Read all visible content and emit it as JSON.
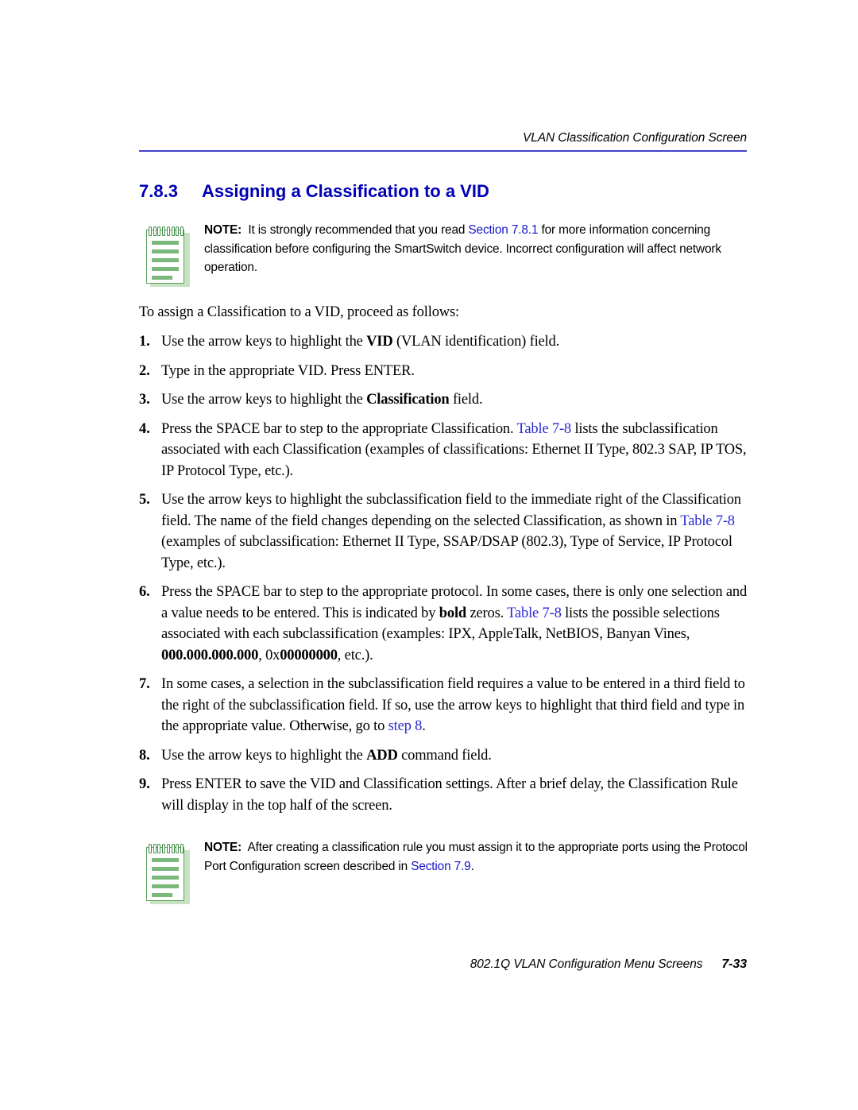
{
  "page": {
    "running_header": "VLAN Classification Configuration Screen",
    "heading_number": "7.8.3",
    "heading_title": "Assigning a Classification to a VID",
    "intro": "To assign a Classification to a VID, proceed as follows:",
    "footer_text": "802.1Q VLAN Configuration Menu Screens",
    "footer_page": "7-33"
  },
  "notes": {
    "first": {
      "label": "NOTE:",
      "text_part1": "It is strongly recommended that you read ",
      "link": "Section 7.8.1",
      "text_part2": " for more information concerning classification before configuring the SmartSwitch device. Incorrect configuration will affect network operation.",
      "icon": "notepad-icon"
    },
    "second": {
      "label": "NOTE:",
      "text_part1": "After creating a classification rule you must assign it to the appropriate ports using the Protocol Port Configuration screen described in ",
      "link": "Section 7.9",
      "text_part2": ".",
      "icon": "notepad-icon"
    }
  },
  "steps": [
    {
      "number": "1.",
      "seg": [
        {
          "t": "Use the arrow keys to highlight the ",
          "s": "normal"
        },
        {
          "t": "VID",
          "s": "bold"
        },
        {
          "t": " (VLAN identification) field.",
          "s": "normal"
        }
      ]
    },
    {
      "number": "2.",
      "seg": [
        {
          "t": "Type in the appropriate VID. Press ENTER.",
          "s": "normal"
        }
      ]
    },
    {
      "number": "3.",
      "seg": [
        {
          "t": "Use the arrow keys to highlight the ",
          "s": "normal"
        },
        {
          "t": "Classification",
          "s": "bold"
        },
        {
          "t": " field.",
          "s": "normal"
        }
      ]
    },
    {
      "number": "4.",
      "seg": [
        {
          "t": "Press the SPACE bar to step to the appropriate Classification. ",
          "s": "normal"
        },
        {
          "t": "Table 7-8",
          "s": "link"
        },
        {
          "t": " lists the subclassification associated with each Classification (examples of classifications: Ethernet II Type, 802.3 SAP, IP TOS, IP Protocol Type, etc.).",
          "s": "normal"
        }
      ]
    },
    {
      "number": "5.",
      "seg": [
        {
          "t": "Use the arrow keys to highlight the subclassification field to the immediate right of the Classification field. The name of the field changes depending on the selected Classification, as shown in ",
          "s": "normal"
        },
        {
          "t": "Table 7-8",
          "s": "link"
        },
        {
          "t": " (examples of subclassification: Ethernet II Type, SSAP/DSAP (802.3), Type of Service, IP Protocol Type, etc.).",
          "s": "normal"
        }
      ]
    },
    {
      "number": "6.",
      "seg": [
        {
          "t": "Press the SPACE bar to step to the appropriate protocol. In some cases, there is only one selection and a value needs to be entered. This is indicated by ",
          "s": "normal"
        },
        {
          "t": "bold",
          "s": "bold"
        },
        {
          "t": " zeros. ",
          "s": "normal"
        },
        {
          "t": "Table 7-8",
          "s": "link"
        },
        {
          "t": " lists the possible selections associated with each subclassification (examples: IPX, AppleTalk, NetBIOS, Banyan Vines, ",
          "s": "normal"
        },
        {
          "t": "000.000.000.000",
          "s": "bold"
        },
        {
          "t": ", 0x",
          "s": "normal"
        },
        {
          "t": "00000000",
          "s": "bold"
        },
        {
          "t": ", etc.).",
          "s": "normal"
        }
      ]
    },
    {
      "number": "7.",
      "seg": [
        {
          "t": "In some cases, a selection in the subclassification field requires a value to be entered in a third field to the right of the subclassification field. If so, use the arrow keys to highlight that third field and type in the appropriate value. Otherwise, go to ",
          "s": "normal"
        },
        {
          "t": "step 8",
          "s": "link"
        },
        {
          "t": ".",
          "s": "normal"
        }
      ]
    },
    {
      "number": "8.",
      "seg": [
        {
          "t": "Use the arrow keys to highlight the ",
          "s": "normal"
        },
        {
          "t": "ADD",
          "s": "bold"
        },
        {
          "t": " command field.",
          "s": "normal"
        }
      ]
    },
    {
      "number": "9.",
      "seg": [
        {
          "t": "Press ENTER to save the VID and Classification settings. After a brief delay, the Classification Rule will display in the top half of the screen.",
          "s": "normal"
        }
      ]
    }
  ],
  "colors": {
    "heading_blue": "#0000b4",
    "rule_blue": "#4141c8",
    "link_blue": "#2a2ad4",
    "note_green": "#7bb87c",
    "note_border_green": "#58a05a"
  }
}
